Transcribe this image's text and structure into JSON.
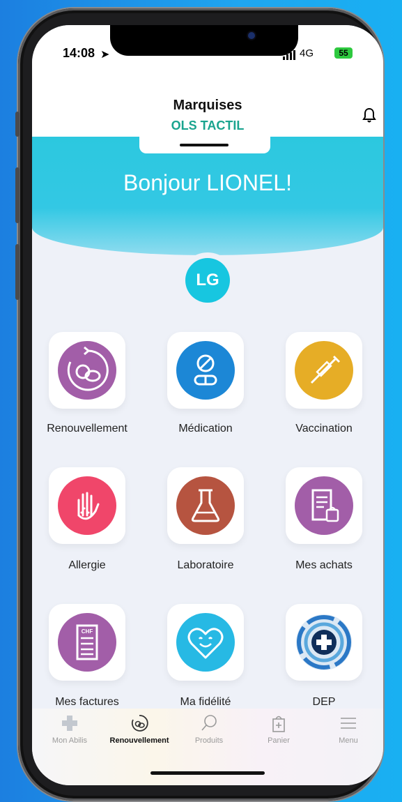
{
  "status": {
    "time": "14:08",
    "network": "4G",
    "battery": "55"
  },
  "header": {
    "store_name": "Marquises",
    "store_sub": "OLS TACTIL"
  },
  "greeting": "Bonjour LIONEL!",
  "avatar": {
    "initials": "LG"
  },
  "colors": {
    "accent": "#17c6e0",
    "brand_green": "#1aa48f",
    "purple": "#a25ea8",
    "blue": "#1c87d6",
    "yellow": "#e6ad26",
    "pink": "#f0466a",
    "brown": "#b65440",
    "cyan": "#27b9e4"
  },
  "tiles": [
    {
      "label": "Renouvellement",
      "icon": "renewal-pills-icon"
    },
    {
      "label": "Médication",
      "icon": "pills-icon"
    },
    {
      "label": "Vaccination",
      "icon": "syringe-icon"
    },
    {
      "label": "Allergie",
      "icon": "allergy-hand-icon"
    },
    {
      "label": "Laboratoire",
      "icon": "flask-icon"
    },
    {
      "label": "Mes achats",
      "icon": "receipt-bag-icon"
    },
    {
      "label": "Mes factures",
      "icon": "invoice-icon"
    },
    {
      "label": "Ma fidélité",
      "icon": "heart-smile-icon"
    },
    {
      "label": "DEP",
      "icon": "dep-cross-icon"
    }
  ],
  "invoice_badge": "CHF",
  "tabbar": [
    {
      "label": "Mon Abilis",
      "icon": "home-cross-icon"
    },
    {
      "label": "Renouvellement",
      "icon": "renewal-icon"
    },
    {
      "label": "Produits",
      "icon": "search-icon"
    },
    {
      "label": "Panier",
      "icon": "bag-icon"
    },
    {
      "label": "Menu",
      "icon": "menu-icon"
    }
  ]
}
